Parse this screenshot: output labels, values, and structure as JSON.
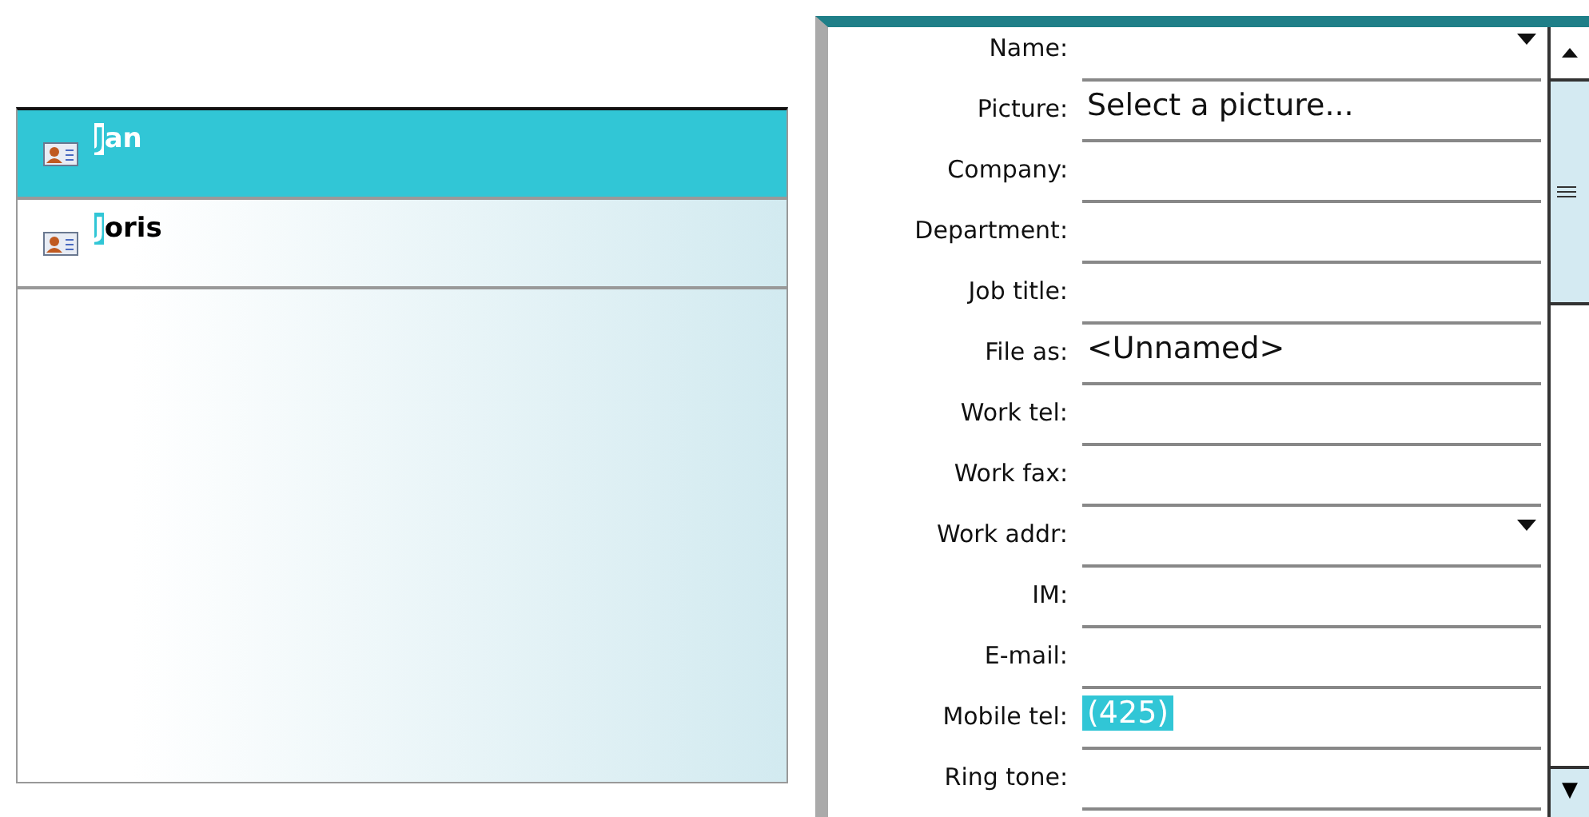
{
  "contacts": [
    {
      "name": "Jan",
      "first_letter_match": true,
      "selected": true
    },
    {
      "name": "Joris",
      "first_letter_match": true,
      "selected": false
    }
  ],
  "fields": [
    {
      "label": "Name:",
      "kind": "dropdown"
    },
    {
      "label": "Picture:",
      "kind": "text",
      "value": "Select a picture..."
    },
    {
      "label": "Company:",
      "kind": "text"
    },
    {
      "label": "Department:",
      "kind": "text"
    },
    {
      "label": "Job title:",
      "kind": "text"
    },
    {
      "label": "File as:",
      "kind": "text",
      "value": "<Unnamed>"
    },
    {
      "label": "Work tel:",
      "kind": "text"
    },
    {
      "label": "Work fax:",
      "kind": "text"
    },
    {
      "label": "Work addr:",
      "kind": "dropdown"
    },
    {
      "label": "IM:",
      "kind": "text"
    },
    {
      "label": "E-mail:",
      "kind": "text"
    },
    {
      "label": "Mobile tel:",
      "kind": "text",
      "value": "(425)",
      "value_selected": true
    },
    {
      "label": "Ring tone:",
      "kind": "text"
    }
  ],
  "scroll_down_arrow": "▼"
}
